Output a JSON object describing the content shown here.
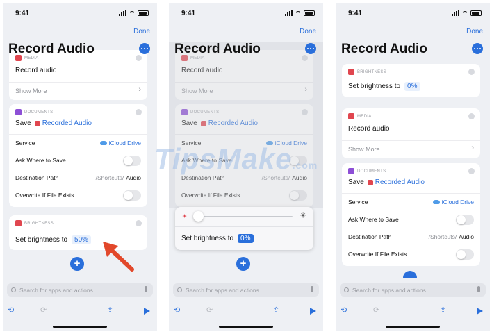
{
  "status": {
    "time": "9:41"
  },
  "header": {
    "done": "Done",
    "title": "Record Audio"
  },
  "media": {
    "category": "MEDIA",
    "action": "Record audio",
    "show_more": "Show More"
  },
  "documents": {
    "category": "DOCUMENTS",
    "action": "Save",
    "token": "Recorded Audio",
    "service_label": "Service",
    "service_value": "iCloud Drive",
    "ask_label": "Ask Where to Save",
    "dest_label": "Destination Path",
    "dest_prefix": "/Shortcuts/",
    "dest_value": "Audio",
    "overwrite_label": "Overwrite If File Exists"
  },
  "brightness": {
    "category": "BRIGHTNESS",
    "action": "Set brightness to",
    "value_panel1": "50%",
    "value_panel2": "0%",
    "value_panel3": "0%",
    "level_panel2": 0
  },
  "search": {
    "placeholder": "Search for apps and actions"
  },
  "icons": {
    "add": "plus-icon",
    "search": "magnifier-icon",
    "mic": "microphone-icon",
    "undo": "undo-icon",
    "redo": "redo-icon",
    "share": "share-icon",
    "run": "play-icon",
    "cloud": "cloud-icon",
    "close": "close-icon",
    "chevron": "chevron-right-icon",
    "arrow": "red-arrow-pointer"
  },
  "watermark": {
    "text": "TipsMake",
    "suffix": ".com"
  },
  "colors": {
    "accent": "#2a6fdb",
    "media_red": "#e0464f",
    "documents_purple": "#8d4fd6",
    "arrow": "#e2482b"
  }
}
